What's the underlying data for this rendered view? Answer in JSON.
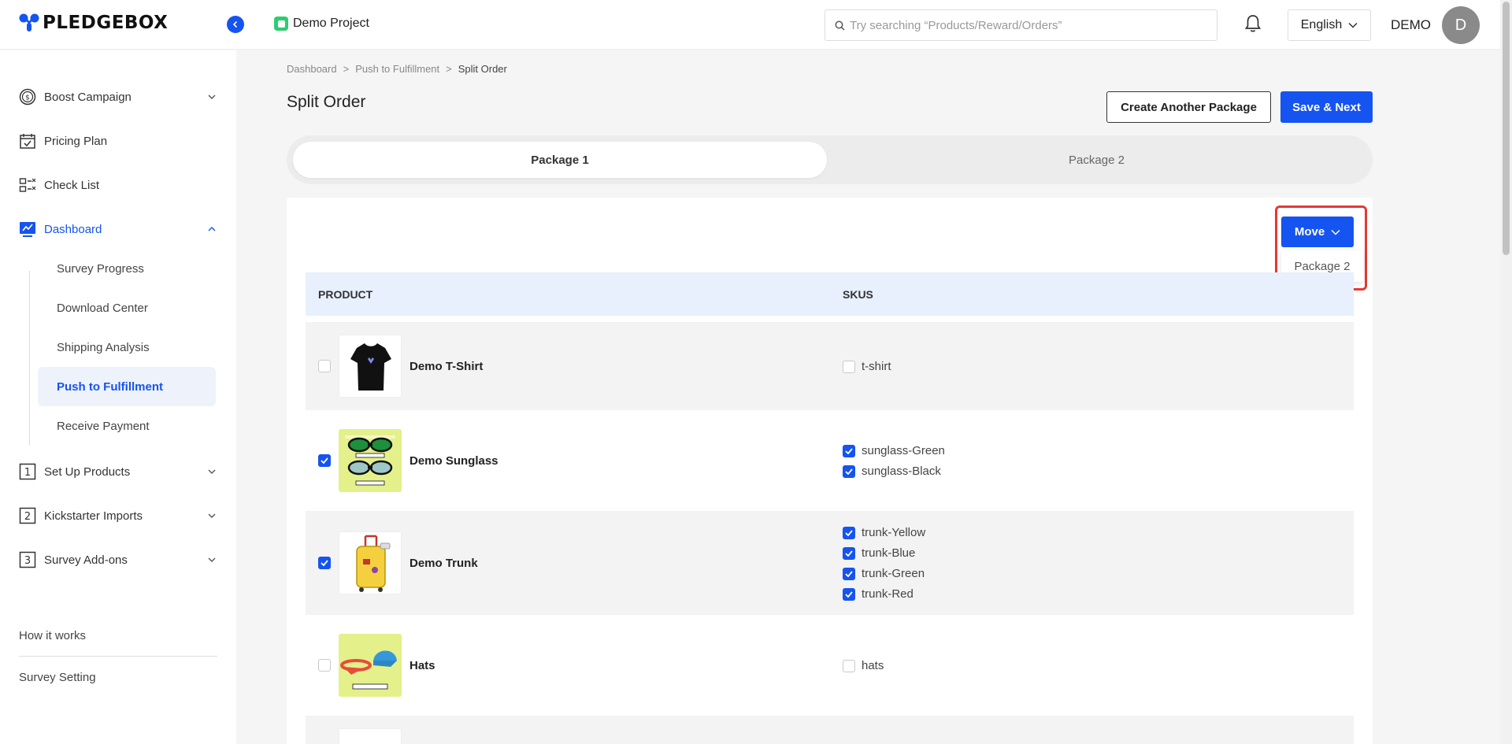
{
  "app": {
    "logo_text": "PLEDGEBOX",
    "project_name": "Demo Project",
    "search_placeholder": "Try searching “Products/Reward/Orders”",
    "language": "English",
    "user_name": "DEMO",
    "avatar_initial": "D"
  },
  "sidebar": {
    "items": [
      {
        "label": "Boost Campaign",
        "icon": "dollar-circle-icon"
      },
      {
        "label": "Pricing Plan",
        "icon": "calendar-check-icon"
      },
      {
        "label": "Check List",
        "icon": "checklist-icon"
      },
      {
        "label": "Dashboard",
        "icon": "dashboard-icon"
      },
      {
        "label": "Set Up Products",
        "icon": "number-1-icon"
      },
      {
        "label": "Kickstarter Imports",
        "icon": "number-2-icon"
      },
      {
        "label": "Survey Add-ons",
        "icon": "number-3-icon"
      }
    ],
    "dashboard_sub": [
      "Survey Progress",
      "Download Center",
      "Shipping Analysis",
      "Push to Fulfillment",
      "Receive Payment"
    ],
    "footer_links": [
      "How it works",
      "Survey Setting"
    ]
  },
  "breadcrumb": [
    "Dashboard",
    "Push to Fulfillment",
    "Split Order"
  ],
  "breadcrumb_sep": ">",
  "page": {
    "title": "Split Order",
    "create_package_label": "Create Another Package",
    "save_next_label": "Save & Next"
  },
  "tabs": [
    "Package 1",
    "Package 2"
  ],
  "move": {
    "label": "Move",
    "options": [
      "Package 2"
    ]
  },
  "table": {
    "headers": [
      "PRODUCT",
      "SKUS"
    ],
    "rows": [
      {
        "name": "Demo T-Shirt",
        "checked": false,
        "skus": [
          {
            "label": "t-shirt",
            "checked": false
          }
        ]
      },
      {
        "name": "Demo Sunglass",
        "checked": true,
        "skus": [
          {
            "label": "sunglass-Green",
            "checked": true
          },
          {
            "label": "sunglass-Black",
            "checked": true
          }
        ]
      },
      {
        "name": "Demo Trunk",
        "checked": true,
        "skus": [
          {
            "label": "trunk-Yellow",
            "checked": true
          },
          {
            "label": "trunk-Blue",
            "checked": true
          },
          {
            "label": "trunk-Green",
            "checked": true
          },
          {
            "label": "trunk-Red",
            "checked": true
          }
        ]
      },
      {
        "name": "Hats",
        "checked": false,
        "skus": [
          {
            "label": "hats",
            "checked": false
          }
        ]
      }
    ]
  },
  "colors": {
    "primary": "#1554f0",
    "highlight_border": "#e53935"
  }
}
